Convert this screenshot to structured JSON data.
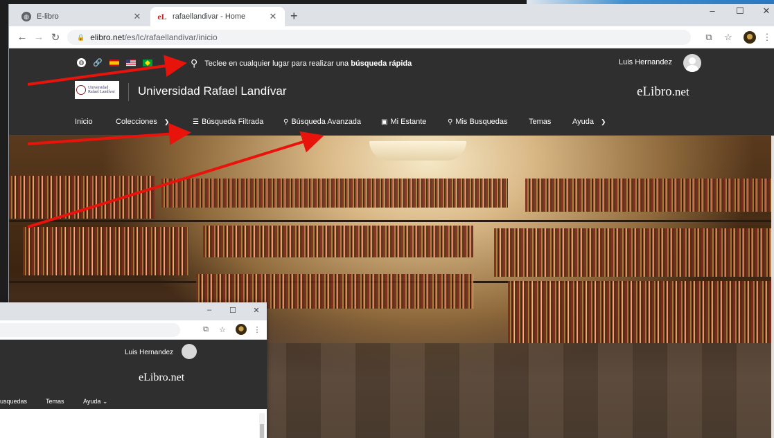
{
  "browser": {
    "tabs": [
      {
        "title": "E-libro",
        "active": false
      },
      {
        "title": "rafaellandivar - Home",
        "active": true
      }
    ],
    "url_domain": "elibro.net",
    "url_path": "/es/lc/rafaellandivar/inicio"
  },
  "site": {
    "quick_search_prefix": "Teclee en cualquier lugar para realizar una ",
    "quick_search_bold": "búsqueda rápida",
    "user_name": "Luis Hernandez",
    "university_name": "Universidad Rafael Landívar",
    "logo_text_line1": "Universidad",
    "logo_text_line2": "Rafael Landívar",
    "brand_main": "eLibro",
    "brand_suffix": ".net",
    "nav": {
      "inicio": "Inicio",
      "colecciones": "Colecciones",
      "busqueda_filtrada": "Búsqueda Filtrada",
      "busqueda_avanzada": "Búsqueda Avanzada",
      "mi_estante": "Mi Estante",
      "mis_busquedas": "Mis Busquedas",
      "temas": "Temas",
      "ayuda": "Ayuda"
    }
  },
  "second_window": {
    "user_name": "Luis Hernandez",
    "brand_main": "eLibro",
    "brand_suffix": ".net",
    "nav_busquedas": "usquedas",
    "nav_temas": "Temas",
    "nav_ayuda": "Ayuda"
  },
  "colors": {
    "site_header_bg": "#2f2f2f",
    "annotation_arrow": "#e8140c",
    "tab_strip": "#dee1e6"
  }
}
